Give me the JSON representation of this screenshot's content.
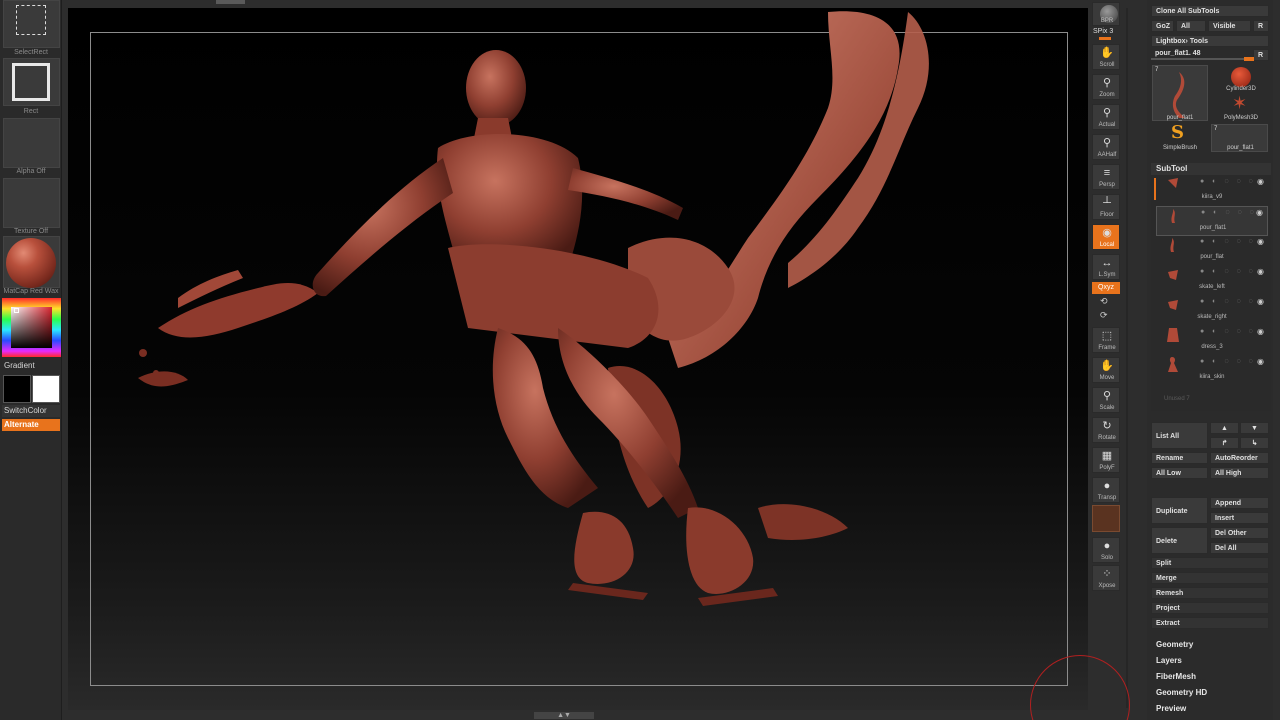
{
  "left_shelf": {
    "select_rect": "SelectRect",
    "rect": "Rect",
    "alpha": "Alpha Off",
    "texture": "Texture Off",
    "material": "MatCap Red Wax",
    "gradient": "Gradient",
    "switch_color": "SwitchColor",
    "alternate": "Alternate",
    "colors": {
      "main": "#d9252f",
      "secondary_black": "#000000",
      "secondary_white": "#ffffff"
    }
  },
  "toolbar": {
    "bpr": "BPR",
    "spix": "SPix 3",
    "scroll": "Scroll",
    "zoom": "Zoom",
    "actual": "Actual",
    "aahalf": "AAHalf",
    "persp": "Persp",
    "floor": "Floor",
    "local": "Local",
    "lsym": "L.Sym",
    "xyz": "Qxyz",
    "frame": "Frame",
    "move": "Move",
    "scale": "Scale",
    "rotate": "Rotate",
    "polyf": "PolyF",
    "transp": "Transp",
    "solo": "Solo",
    "xpose": "Xpose"
  },
  "palette": {
    "clone_all": "Clone All SubTools",
    "goz": "GoZ",
    "all": "All",
    "visible": "Visible",
    "r": "R",
    "lightbox_tools": "Lightbox› Tools",
    "tool_slider": "pour_flat1. 48",
    "thumbs": [
      {
        "label": "pour_flat1",
        "num": "7"
      },
      {
        "label": "Cylinder3D"
      },
      {
        "label": "PolyMesh3D"
      },
      {
        "label": "SimpleBrush"
      },
      {
        "label": "pour_flat1",
        "num": "7"
      }
    ],
    "subtool_title": "SubTool",
    "subtools": [
      "kiira_v9",
      "pour_flat1",
      "pour_flat",
      "skate_left",
      "skate_right",
      "dress_3",
      "kiira_skin"
    ],
    "unused": "Unused 7",
    "list_all": "List All",
    "rename": "Rename",
    "autoreorder": "AutoReorder",
    "all_low": "All Low",
    "all_high": "All High",
    "duplicate": "Duplicate",
    "append": "Append",
    "insert": "Insert",
    "delete": "Delete",
    "del_other": "Del Other",
    "del_all": "Del All",
    "split": "Split",
    "merge": "Merge",
    "remesh": "Remesh",
    "project": "Project",
    "extract": "Extract",
    "sections": [
      "Geometry",
      "Layers",
      "FiberMesh",
      "Geometry HD",
      "Preview"
    ]
  }
}
